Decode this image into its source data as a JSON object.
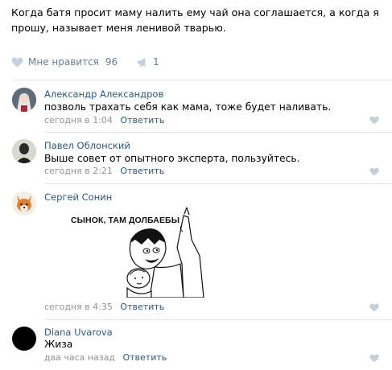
{
  "post": {
    "text": "Когда батя просит маму налить ему чай она соглашается, а когда я прошу, называет меня ленивой тварью.",
    "like_label": "Мне нравится",
    "like_count": "96",
    "share_count": "1"
  },
  "comments": [
    {
      "author": "Александр Александров",
      "text": "позволь трахать себя как мама, тоже будет наливать.",
      "time": "сегодня в 1:04",
      "reply": "Ответить",
      "avatar_icon": "anime-character-avatar"
    },
    {
      "author": "Павел Облонский",
      "text": "Выше совет от опытного эксперта, пользуйтесь.",
      "time": "сегодня в 2:21",
      "reply": "Ответить",
      "avatar_icon": "person-photo-avatar"
    },
    {
      "author": "Сергей Сонин",
      "meme_caption": "СЫНОК, ТАМ ДОЛБАЕБЫ",
      "time": "сегодня в 4:35",
      "reply": "Ответить",
      "avatar_icon": "fox-avatar"
    },
    {
      "author": "Diana Uvarova",
      "text": "Жиза",
      "time": "два часа назад",
      "reply": "Ответить",
      "avatar_icon": "black-avatar"
    }
  ],
  "colors": {
    "link": "#2a5885",
    "meta": "#939393",
    "icon": "#c5d0db"
  }
}
